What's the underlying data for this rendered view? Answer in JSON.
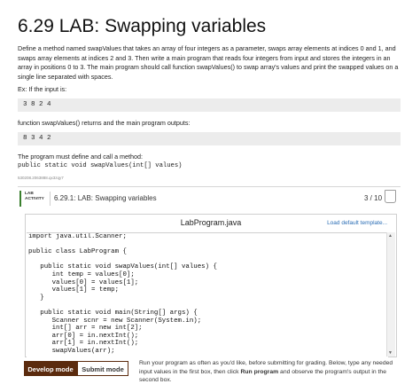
{
  "lab": {
    "title": "6.29 LAB: Swapping variables",
    "description": "Define a method named swapValues that takes an array of four integers as a parameter, swaps array elements at indices 0 and 1, and swaps array elements at indices 2 and 3. Then write a main program that reads four integers from input and stores the integers in an array in positions 0 to 3. The main program should call function swapValues() to swap array's values and print the swapped values on a single line separated with spaces.",
    "example_intro": "Ex: If the input is:",
    "example_input": "3 8 2 4",
    "example_output_intro": "function swapValues() returns and the main program outputs:",
    "example_output": "8 3 4 2",
    "must_define": "The program must define and call a method:",
    "signature": "public static void swapValues(int[] values)",
    "small_id": "530208.2063888.qx3zqy7"
  },
  "activity": {
    "badge_line1": "LAB",
    "badge_line2": "ACTIVITY",
    "title": "6.29.1: LAB: Swapping variables",
    "progress": "3 / 10"
  },
  "editor": {
    "filename": "LabProgram.java",
    "load_default": "Load default template...",
    "code": [
      "import java.util.Scanner;",
      "",
      "public class LabProgram {",
      "",
      "   public static void swapValues(int[] values) {",
      "      int temp = values[0];",
      "      values[0] = values[1];",
      "      values[1] = temp;",
      "   }",
      "",
      "   public static void main(String[] args) {",
      "      Scanner scnr = new Scanner(System.in);",
      "      int[] arr = new int[2];",
      "      arr[0] = in.nextInt();",
      "      arr[1] = in.nextInt();",
      "      swapValues(arr);"
    ]
  },
  "modes": {
    "develop_label": "Develop mode",
    "submit_label": "Submit mode",
    "help_pre": "Run your program as often as you'd like, before submitting for grading. Below, type any needed input values in the first box, then click ",
    "help_bold": "Run program",
    "help_post": " and observe the program's output in the second box."
  },
  "colors": {
    "develop_bg": "#5b2b0e",
    "activity_accent": "#3a7f2e",
    "link": "#2a6db5"
  },
  "icons": {
    "flag": "bookmark-flag-icon",
    "scroll_up": "scroll-up-arrow-icon",
    "scroll_down": "scroll-down-arrow-icon"
  }
}
